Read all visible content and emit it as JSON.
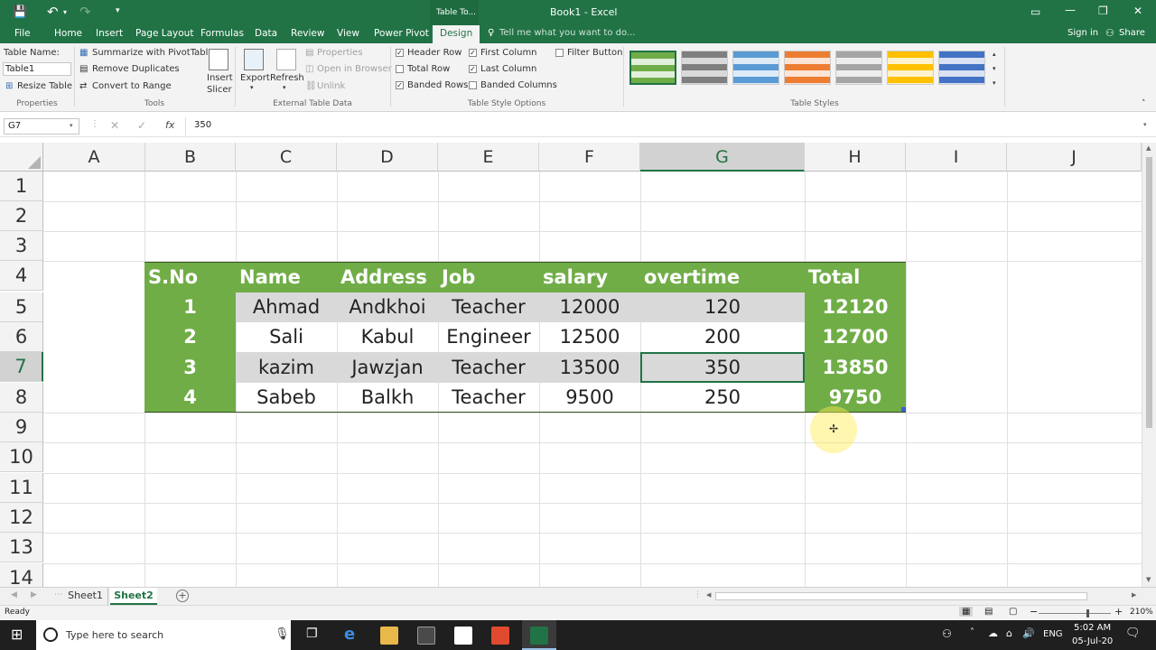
{
  "window": {
    "title": "Book1 - Excel",
    "context_tab": "Table To...",
    "controls": [
      "▭",
      "—",
      "❐",
      "✕"
    ]
  },
  "qat": {
    "save": "💾",
    "undo": "↶",
    "redo": "↷",
    "more": "▾"
  },
  "tabs": [
    "File",
    "Home",
    "Insert",
    "Page Layout",
    "Formulas",
    "Data",
    "Review",
    "View",
    "Power Pivot",
    "Design"
  ],
  "tell_me": "Tell me what you want to do...",
  "signin": "Sign in",
  "share": "Share",
  "ribbon": {
    "properties": {
      "name_label": "Table Name:",
      "name_value": "Table1",
      "resize": "Resize Table",
      "group": "Properties"
    },
    "tools": {
      "summarize": "Summarize with PivotTable",
      "remove_dup": "Remove Duplicates",
      "convert": "Convert to Range",
      "group": "Tools"
    },
    "slicer": {
      "insert": "Insert",
      "slicer": "Slicer"
    },
    "external": {
      "export": "Export",
      "refresh": "Refresh",
      "properties": "Properties",
      "open_browser": "Open in Browser",
      "unlink": "Unlink",
      "group": "External Table Data"
    },
    "style_options": {
      "header_row": "Header Row",
      "total_row": "Total Row",
      "banded_rows": "Banded Rows",
      "first_column": "First Column",
      "last_column": "Last Column",
      "banded_columns": "Banded Columns",
      "filter_button": "Filter Button",
      "group": "Table Style Options",
      "checked": {
        "header_row": true,
        "total_row": false,
        "banded_rows": true,
        "first_column": true,
        "last_column": true,
        "banded_columns": false,
        "filter_button": false
      }
    },
    "styles": {
      "group": "Table Styles",
      "swatches": [
        "#70ad47",
        "#7f7f7f",
        "#5b9bd5",
        "#ed7d31",
        "#a5a5a5",
        "#ffc000",
        "#4472c4"
      ]
    }
  },
  "formula_bar": {
    "name_box": "G7",
    "fx": "fx",
    "value": "350"
  },
  "columns": [
    "A",
    "B",
    "C",
    "D",
    "E",
    "F",
    "G",
    "H",
    "I",
    "J"
  ],
  "rows": [
    "1",
    "2",
    "3",
    "4",
    "5",
    "6",
    "7",
    "8",
    "9",
    "10",
    "11",
    "12",
    "13",
    "14"
  ],
  "table": {
    "headers": [
      "S.No",
      "Name",
      "Address",
      "Job",
      "salary",
      "overtime",
      "Total"
    ],
    "rows": [
      [
        "1",
        "Ahmad",
        "Andkhoi",
        "Teacher",
        "12000",
        "120",
        "12120"
      ],
      [
        "2",
        "Sali",
        "Kabul",
        "Engineer",
        "12500",
        "200",
        "12700"
      ],
      [
        "3",
        "kazim",
        "Jawzjan",
        "Teacher",
        "13500",
        "350",
        "13850"
      ],
      [
        "4",
        "Sabeb",
        "Balkh",
        "Teacher",
        "9500",
        "250",
        "9750"
      ]
    ]
  },
  "sheets": [
    "Sheet1",
    "Sheet2"
  ],
  "active_sheet": "Sheet2",
  "status": {
    "ready": "Ready",
    "zoom": "210%"
  },
  "taskbar": {
    "search": "Type here to search",
    "lang": "ENG",
    "time": "5:02 AM",
    "date": "05-Jul-20"
  },
  "colors": {
    "accent": "#217346",
    "table_green": "#70ad47",
    "band_gray": "#d9d9d9"
  }
}
